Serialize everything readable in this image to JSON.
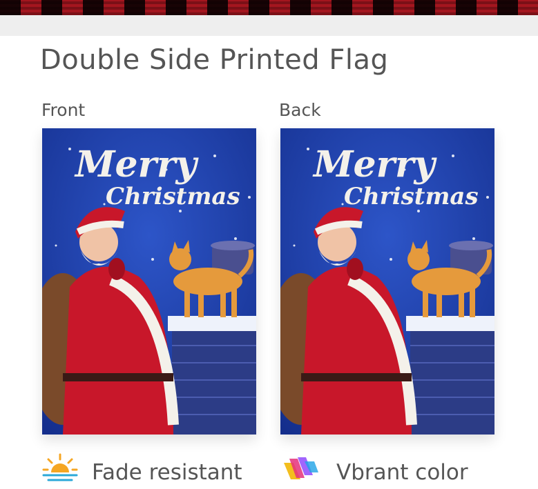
{
  "header": {
    "title": "Double Side Printed Flag"
  },
  "sides": [
    {
      "label": "Front",
      "flag_text": [
        "Merry",
        "Christmas"
      ]
    },
    {
      "label": "Back",
      "flag_text": [
        "Merry",
        "Christmas"
      ]
    }
  ],
  "features": [
    {
      "icon": "sun-icon",
      "label": "Fade resistant"
    },
    {
      "icon": "color-petals-icon",
      "label": "Vbrant color"
    }
  ],
  "colors": {
    "plaid_red": "#a4161f",
    "sky_blue": "#1d3da8",
    "santa_red": "#c8172a",
    "cat_orange": "#e59a3c",
    "sun_orange": "#f5a623"
  }
}
